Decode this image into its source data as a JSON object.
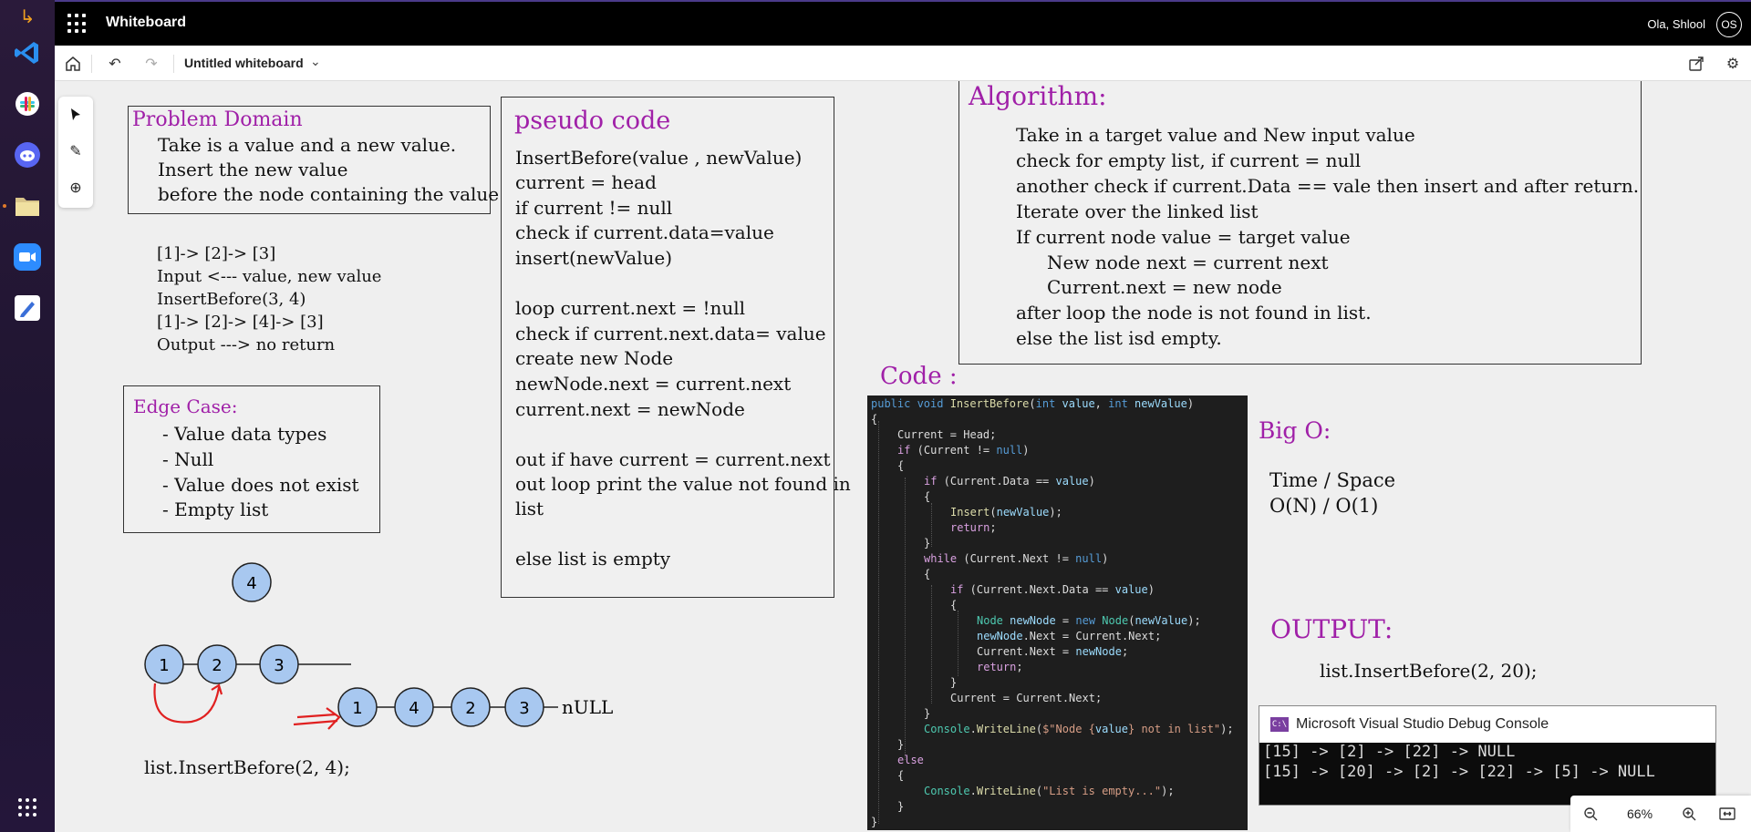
{
  "app": {
    "title": "Whiteboard",
    "user_name": "Ola, Shlool",
    "avatar_initials": "OS"
  },
  "toolbar": {
    "board_title": "Untitled whiteboard"
  },
  "problem_domain": {
    "heading": "Problem Domain",
    "lines": [
      "Take is a value and a new value.",
      "Insert the new value",
      "before the node containing the value."
    ]
  },
  "example": {
    "lines": [
      "[1]-> [2]-> [3]",
      "Input <--- value, new value",
      "InsertBefore(3, 4)",
      "[1]-> [2]-> [4]-> [3]",
      "Output ---> no return"
    ]
  },
  "edge_case": {
    "heading": "Edge Case:",
    "lines": [
      "- Value data types",
      "- Null",
      "- Value does not exist",
      "- Empty list"
    ]
  },
  "diagram": {
    "new_node": "4",
    "list_before": [
      "1",
      "2",
      "3"
    ],
    "list_after": [
      "1",
      "4",
      "2",
      "3"
    ],
    "null_label": "nULL",
    "call": "list.InsertBefore(2, 4);"
  },
  "pseudo": {
    "heading": "pseudo code",
    "lines": [
      "InsertBefore(value , newValue)",
      "current = head",
      "if current != null",
      "check if current.data=value",
      "insert(newValue)",
      "",
      "loop current.next = !null",
      "check if current.next.data= value",
      "create new Node",
      "newNode.next = current.next",
      "current.next = newNode",
      "",
      "out if have current = current.next",
      "out loop print the value not found in",
      "list",
      "",
      "else list is empty"
    ]
  },
  "algorithm": {
    "heading": "Algorithm:",
    "lines": [
      "Take in a target value and New input value",
      "check for empty list, if current = null",
      "another check if current.Data == vale then insert and after return.",
      "Iterate over the linked list",
      "If current node value = target value",
      "New node next = current next",
      "Current.next = new node",
      "after loop the node is not found in list.",
      "else the list isd empty."
    ]
  },
  "code": {
    "heading": "Code :"
  },
  "big_o": {
    "heading": "Big O:",
    "line1": "Time / Space",
    "line2": "O(N) / O(1)"
  },
  "output": {
    "heading": "OUTPUT:",
    "call": "list.InsertBefore(2, 20);",
    "console_title": "Microsoft Visual Studio Debug Console",
    "console_lines": [
      "[15] -> [2] -> [22] -> NULL",
      "[15] -> [20] -> [2] -> [22] -> [5] -> NULL"
    ]
  },
  "zoom": {
    "level": "66%"
  },
  "colors": {
    "accent_purple": "#a020a8",
    "node_fill": "#a8c8f0",
    "arrow_red": "#e02020"
  }
}
